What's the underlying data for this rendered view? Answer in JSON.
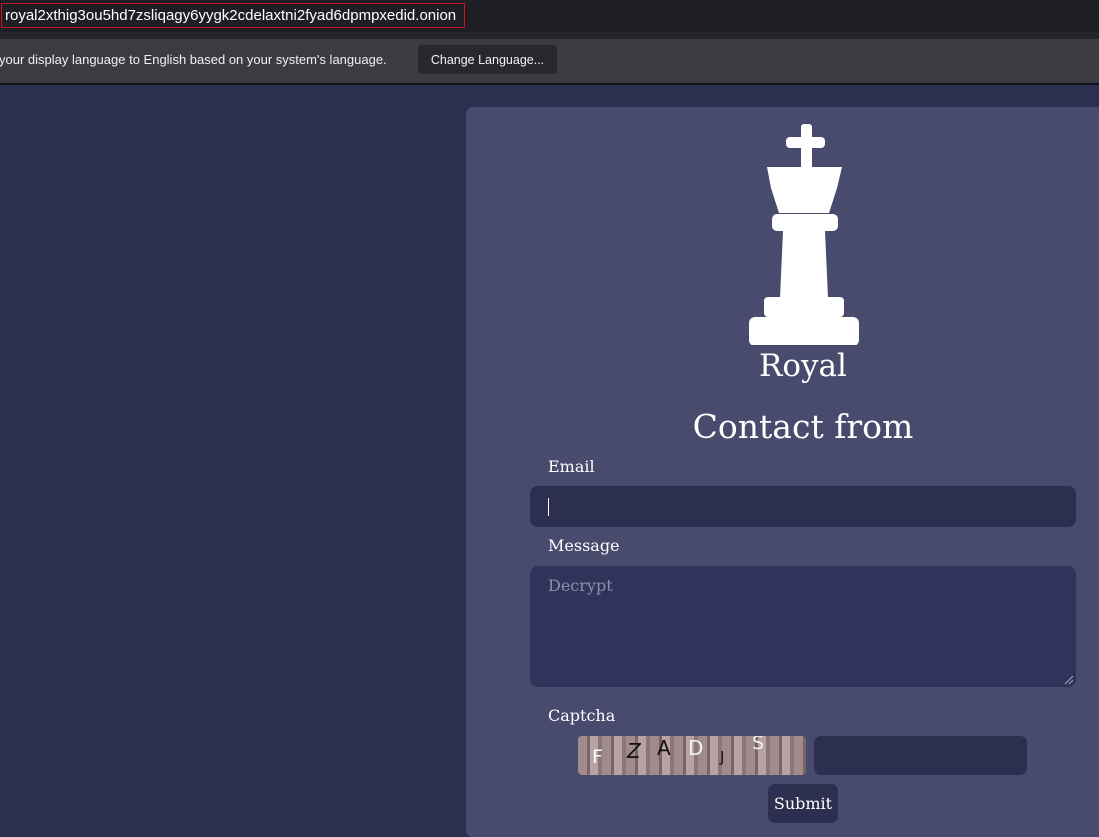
{
  "browser": {
    "url": "royal2xthig3ou5hd7zsliqagy6yygk2cdelaxtni2fyad6dpmpxedid.onion"
  },
  "notification": {
    "text": "your display language to English based on your system's language.",
    "button_label": "Change Language..."
  },
  "page": {
    "logo_icon": "chess-king-icon",
    "brand": "Royal",
    "form_title": "Contact from",
    "email": {
      "label": "Email",
      "value": ""
    },
    "message": {
      "label": "Message",
      "placeholder": "Decrypt",
      "value": ""
    },
    "captcha": {
      "label": "Captcha",
      "chars": [
        "F",
        "Z",
        "A",
        "D",
        "J",
        "S"
      ],
      "value": ""
    },
    "submit_label": "Submit"
  },
  "colors": {
    "page_bg": "#2c2f50",
    "panel_bg": "#484b6e",
    "input_bg": "#2c2f50",
    "url_highlight": "#c0191f"
  }
}
